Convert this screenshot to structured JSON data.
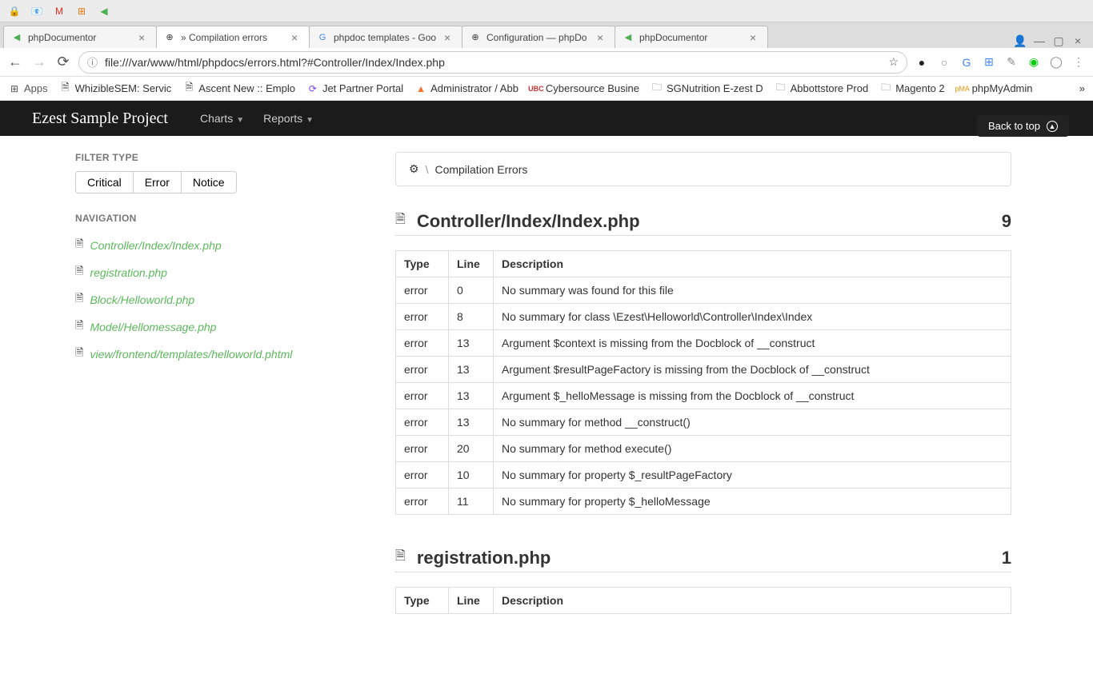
{
  "taskbar_icons": [
    "lock",
    "outlook",
    "gmail",
    "office",
    "phpdoc"
  ],
  "browser_tabs": [
    {
      "title": "phpDocumentor",
      "favicon": "phpdoc-green"
    },
    {
      "title": "» Compilation errors",
      "favicon": "phpdoc-dark",
      "active": true
    },
    {
      "title": "phpdoc templates - Goo",
      "favicon": "google"
    },
    {
      "title": "Configuration — phpDo",
      "favicon": "phpdoc-dark"
    },
    {
      "title": "phpDocumentor",
      "favicon": "phpdoc-green"
    }
  ],
  "address_url": "file:///var/www/html/phpdocs/errors.html?#Controller/Index/Index.php",
  "bookmarks": [
    {
      "label": "Apps",
      "icon": "apps"
    },
    {
      "label": "WhizibleSEM: Servic",
      "icon": "page"
    },
    {
      "label": "Ascent New :: Emplo",
      "icon": "page"
    },
    {
      "label": "Jet Partner Portal",
      "icon": "jet"
    },
    {
      "label": "Administrator / Abb",
      "icon": "gitlab"
    },
    {
      "label": "Cybersource Busine",
      "icon": "ubc"
    },
    {
      "label": "SGNutrition E-zest D",
      "icon": "folder"
    },
    {
      "label": "Abbottstore Prod",
      "icon": "folder"
    },
    {
      "label": "Magento 2",
      "icon": "folder"
    },
    {
      "label": "phpMyAdmin",
      "icon": "pma"
    }
  ],
  "page_nav": {
    "brand": "Ezest Sample Project",
    "menus": [
      "Charts",
      "Reports"
    ]
  },
  "back_to_top": "Back to top",
  "sidebar": {
    "filter_heading": "FILTER TYPE",
    "filters": [
      "Critical",
      "Error",
      "Notice"
    ],
    "nav_heading": "NAVIGATION",
    "nav_items": [
      "Controller/Index/Index.php",
      "registration.php",
      "Block/Helloworld.php",
      "Model/Hellomessage.php",
      "view/frontend/templates/helloworld.phtml"
    ]
  },
  "breadcrumb": {
    "slash": "\\",
    "label": "Compilation Errors"
  },
  "files": [
    {
      "name": "Controller/Index/Index.php",
      "count": "9",
      "headers": [
        "Type",
        "Line",
        "Description"
      ],
      "rows": [
        {
          "type": "error",
          "line": "0",
          "desc": "No summary was found for this file"
        },
        {
          "type": "error",
          "line": "8",
          "desc": "No summary for class \\Ezest\\Helloworld\\Controller\\Index\\Index"
        },
        {
          "type": "error",
          "line": "13",
          "desc": "Argument $context is missing from the Docblock of __construct"
        },
        {
          "type": "error",
          "line": "13",
          "desc": "Argument $resultPageFactory is missing from the Docblock of __construct"
        },
        {
          "type": "error",
          "line": "13",
          "desc": "Argument $_helloMessage is missing from the Docblock of __construct"
        },
        {
          "type": "error",
          "line": "13",
          "desc": "No summary for method __construct()"
        },
        {
          "type": "error",
          "line": "20",
          "desc": "No summary for method execute()"
        },
        {
          "type": "error",
          "line": "10",
          "desc": "No summary for property $_resultPageFactory"
        },
        {
          "type": "error",
          "line": "11",
          "desc": "No summary for property $_helloMessage"
        }
      ]
    },
    {
      "name": "registration.php",
      "count": "1",
      "headers": [
        "Type",
        "Line",
        "Description"
      ],
      "rows": []
    }
  ]
}
